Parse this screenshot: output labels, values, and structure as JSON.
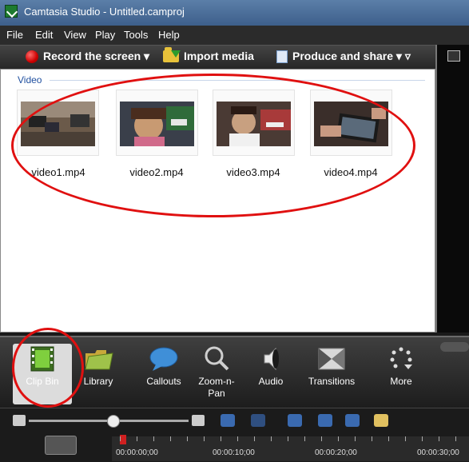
{
  "window": {
    "title": "Camtasia Studio - Untitled.camproj"
  },
  "menu": [
    "File",
    "Edit",
    "View",
    "Play",
    "Tools",
    "Help"
  ],
  "toolbar": {
    "record_label": "Record the screen ▾",
    "import_label": "Import media",
    "produce_label": "Produce and share ▾ ▿"
  },
  "clipbin": {
    "section_label": "Video",
    "files": [
      "video1.mp4",
      "video2.mp4",
      "video3.mp4",
      "video4.mp4"
    ]
  },
  "tabs": [
    {
      "label": "Clip Bin",
      "icon": "film-strip-icon",
      "active": true
    },
    {
      "label": "Library",
      "icon": "library-folder-icon"
    },
    {
      "label": "Callouts",
      "icon": "speech-bubble-icon"
    },
    {
      "label": "Zoom-n-Pan",
      "icon": "magnifier-icon"
    },
    {
      "label": "Audio",
      "icon": "speaker-icon"
    },
    {
      "label": "Transitions",
      "icon": "transitions-icon"
    },
    {
      "label": "More",
      "icon": "more-dots-icon"
    }
  ],
  "timeline": {
    "timestamps": [
      "00:00:00;00",
      "00:00:10;00",
      "00:00:20;00",
      "00:00:30;00"
    ]
  },
  "colors": {
    "annotation": "#e01010",
    "section_label": "#1f4f9f"
  }
}
